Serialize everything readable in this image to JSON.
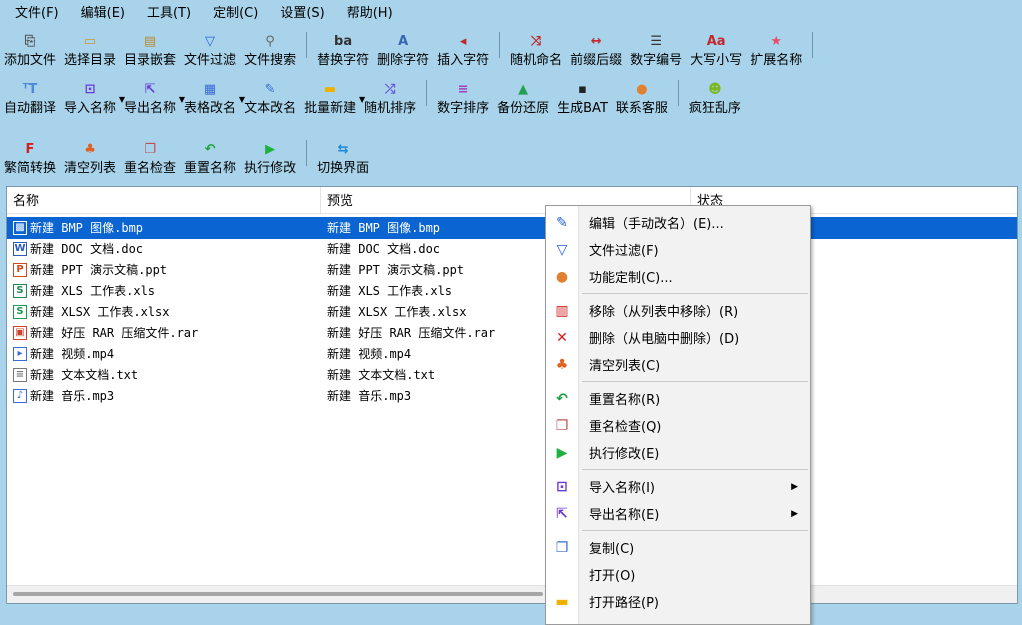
{
  "menubar": [
    "文件(F)",
    "编辑(E)",
    "工具(T)",
    "定制(C)",
    "设置(S)",
    "帮助(H)"
  ],
  "toolbar": {
    "row1": [
      {
        "id": "add-file",
        "label": "添加文件",
        "icon": "add-file-icon",
        "glyph": "⎘",
        "color": "#555555"
      },
      {
        "id": "select-dir",
        "label": "选择目录",
        "icon": "folder-open-icon",
        "glyph": "▭",
        "color": "#c99a2e"
      },
      {
        "id": "dir-nest",
        "label": "目录嵌套",
        "icon": "folder-nest-icon",
        "glyph": "▤",
        "color": "#b88a2a"
      },
      {
        "id": "file-filter",
        "label": "文件过滤",
        "icon": "filter-icon",
        "glyph": "▽",
        "color": "#2a62d8"
      },
      {
        "id": "file-search",
        "label": "文件搜索",
        "icon": "search-icon",
        "glyph": "⚲",
        "color": "#666666"
      },
      "sep",
      {
        "id": "replace-char",
        "label": "替换字符",
        "icon": "replace-char-icon",
        "glyph": "ba",
        "color": "#333333"
      },
      {
        "id": "delete-char",
        "label": "删除字符",
        "icon": "delete-char-icon",
        "glyph": "A",
        "color": "#3a66b0"
      },
      {
        "id": "insert-char",
        "label": "插入字符",
        "icon": "insert-char-icon",
        "glyph": "◂",
        "color": "#c0282d"
      },
      "sep",
      {
        "id": "random-name",
        "label": "随机命名",
        "icon": "shuffle-icon",
        "glyph": "⤨",
        "color": "#c0282d"
      },
      {
        "id": "prefix-suffix",
        "label": "前缀后缀",
        "icon": "swap-arrows-icon",
        "glyph": "↔",
        "color": "#c0282d"
      },
      {
        "id": "number-seq",
        "label": "数字编号",
        "icon": "numbered-list-icon",
        "glyph": "☰",
        "color": "#333333"
      },
      {
        "id": "case",
        "label": "大写小写",
        "icon": "case-icon",
        "glyph": "Aa",
        "color": "#c0282d"
      },
      {
        "id": "extension",
        "label": "扩展名称",
        "icon": "star-icon",
        "glyph": "★",
        "color": "#e84a6a"
      },
      "sep"
    ],
    "row2": [
      {
        "id": "auto-translate",
        "label": "自动翻译",
        "icon": "translate-icon",
        "glyph": "ᵀT",
        "color": "#4a8ad8"
      },
      {
        "id": "import-names",
        "label": "导入名称",
        "icon": "import-icon",
        "glyph": "⊡",
        "color": "#6a3ad8",
        "dropdown": true
      },
      {
        "id": "export-names",
        "label": "导出名称",
        "icon": "export-icon",
        "glyph": "⇱",
        "color": "#6a3ad8",
        "dropdown": true
      },
      {
        "id": "table-rename",
        "label": "表格改名",
        "icon": "table-icon",
        "glyph": "▦",
        "color": "#3a6ad8",
        "dropdown": true
      },
      {
        "id": "text-rename",
        "label": "文本改名",
        "icon": "edit-icon",
        "glyph": "✎",
        "color": "#3a6ad8"
      },
      {
        "id": "batch-new",
        "label": "批量新建",
        "icon": "new-folder-icon",
        "glyph": "▬",
        "color": "#f0b000",
        "dropdown": true
      },
      {
        "id": "random-sort",
        "label": "随机排序",
        "icon": "random-sort-icon",
        "glyph": "⤮",
        "color": "#6a5ad8"
      },
      "sep",
      {
        "id": "number-sort",
        "label": "数字排序",
        "icon": "sort-lines-icon",
        "glyph": "≡",
        "color": "#a040c0"
      },
      {
        "id": "backup-restore",
        "label": "备份还原",
        "icon": "drive-icon",
        "glyph": "▲",
        "color": "#22a050"
      },
      {
        "id": "generate-bat",
        "label": "生成BAT",
        "icon": "terminal-icon",
        "glyph": "▪",
        "color": "#222222"
      },
      {
        "id": "contact-support",
        "label": "联系客服",
        "icon": "user-icon",
        "glyph": "●",
        "color": "#e08030"
      },
      "sep",
      {
        "id": "crazy-shuffle",
        "label": "疯狂乱序",
        "icon": "frog-icon",
        "glyph": "☻",
        "color": "#7ab820"
      }
    ],
    "row3": [
      {
        "id": "trad-simp",
        "label": "繁简转换",
        "icon": "font-f-icon",
        "glyph": "F",
        "color": "#d02020"
      },
      {
        "id": "clear-list",
        "label": "清空列表",
        "icon": "broom-icon",
        "glyph": "♣",
        "color": "#e06020"
      },
      {
        "id": "dup-check",
        "label": "重名检查",
        "icon": "duplicate-icon",
        "glyph": "❐",
        "color": "#c05050"
      },
      {
        "id": "reset-name",
        "label": "重置名称",
        "icon": "undo-icon",
        "glyph": "↶",
        "color": "#20a040"
      },
      {
        "id": "execute",
        "label": "执行修改",
        "icon": "play-icon",
        "glyph": "▶",
        "color": "#20b040"
      },
      "sep",
      {
        "id": "switch-ui",
        "label": "切换界面",
        "icon": "switch-icon",
        "glyph": "⇆",
        "color": "#1a8ad8"
      }
    ]
  },
  "list": {
    "columns": [
      "名称",
      "预览",
      "状态"
    ],
    "rows": [
      {
        "name": "新建 BMP 图像.bmp",
        "preview": "新建 BMP 图像.bmp",
        "icon": "bmp-file-icon",
        "glyph": "▩",
        "color": "#4a7ad0",
        "selected": true
      },
      {
        "name": "新建 DOC 文档.doc",
        "preview": "新建 DOC 文档.doc",
        "icon": "doc-file-icon",
        "glyph": "W",
        "color": "#2a5ab8"
      },
      {
        "name": "新建 PPT 演示文稿.ppt",
        "preview": "新建 PPT 演示文稿.ppt",
        "icon": "ppt-file-icon",
        "glyph": "P",
        "color": "#d04a20"
      },
      {
        "name": "新建 XLS 工作表.xls",
        "preview": "新建 XLS 工作表.xls",
        "icon": "xls-file-icon",
        "glyph": "S",
        "color": "#20884a"
      },
      {
        "name": "新建 XLSX 工作表.xlsx",
        "preview": "新建 XLSX 工作表.xlsx",
        "icon": "xlsx-file-icon",
        "glyph": "S",
        "color": "#1a9a4a"
      },
      {
        "name": "新建 好压 RAR 压缩文件.rar",
        "preview": "新建 好压 RAR 压缩文件.rar",
        "icon": "rar-file-icon",
        "glyph": "▣",
        "color": "#d0402a"
      },
      {
        "name": "新建 视频.mp4",
        "preview": "新建 视频.mp4",
        "icon": "video-file-icon",
        "glyph": "▸",
        "color": "#3a6ad8"
      },
      {
        "name": "新建 文本文档.txt",
        "preview": "新建 文本文档.txt",
        "icon": "txt-file-icon",
        "glyph": "≡",
        "color": "#777777"
      },
      {
        "name": "新建 音乐.mp3",
        "preview": "新建 音乐.mp3",
        "icon": "audio-file-icon",
        "glyph": "♪",
        "color": "#3a6ad8"
      }
    ]
  },
  "context_menu": {
    "items": [
      {
        "id": "edit",
        "label": "编辑（手动改名）(E)...",
        "icon": "edit-icon",
        "glyph": "✎",
        "color": "#2a62d8"
      },
      {
        "id": "filter",
        "label": "文件过滤(F)",
        "icon": "filter-icon",
        "glyph": "▽",
        "color": "#2a62d8"
      },
      {
        "id": "customize",
        "label": "功能定制(C)...",
        "icon": "user-icon",
        "glyph": "●",
        "color": "#e08030"
      },
      "sep",
      {
        "id": "remove",
        "label": "移除（从列表中移除）(R)",
        "icon": "trash-icon",
        "glyph": "▥",
        "color": "#d02020"
      },
      {
        "id": "delete",
        "label": "删除（从电脑中删除）(D)",
        "icon": "delete-x-icon",
        "glyph": "✕",
        "color": "#d02020"
      },
      {
        "id": "clear",
        "label": "清空列表(C)",
        "icon": "broom-icon",
        "glyph": "♣",
        "color": "#e06020"
      },
      "sep",
      {
        "id": "reset",
        "label": "重置名称(R)",
        "icon": "undo-icon",
        "glyph": "↶",
        "color": "#20a040"
      },
      {
        "id": "dupcheck",
        "label": "重名检查(Q)",
        "icon": "duplicate-icon",
        "glyph": "❐",
        "color": "#c05050"
      },
      {
        "id": "execute",
        "label": "执行修改(E)",
        "icon": "play-icon",
        "glyph": "▶",
        "color": "#20b040"
      },
      "sep",
      {
        "id": "import",
        "label": "导入名称(I)",
        "icon": "import-icon",
        "glyph": "⊡",
        "color": "#6a3ad8",
        "submenu": true
      },
      {
        "id": "export",
        "label": "导出名称(E)",
        "icon": "export-icon",
        "glyph": "⇱",
        "color": "#6a3ad8",
        "submenu": true
      },
      "sep",
      {
        "id": "copy",
        "label": "复制(C)",
        "icon": "copy-icon",
        "glyph": "❐",
        "color": "#3a6ad8"
      },
      {
        "id": "open",
        "label": "打开(O)",
        "icon": "",
        "glyph": "",
        "color": "#000000"
      },
      {
        "id": "open-path",
        "label": "打开路径(P)",
        "icon": "folder-icon",
        "glyph": "▬",
        "color": "#f0b000"
      }
    ]
  }
}
